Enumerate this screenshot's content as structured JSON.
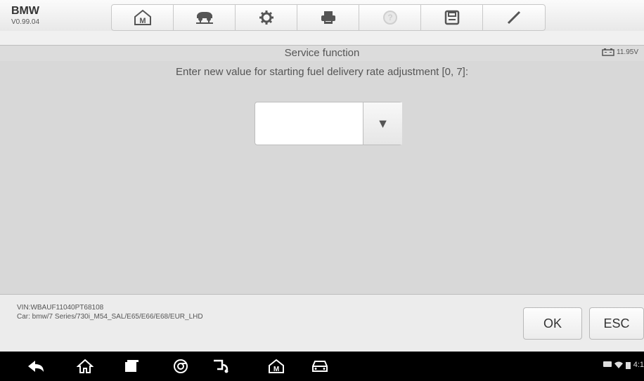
{
  "header": {
    "brand": "BMW",
    "version": "V0.99.04"
  },
  "toolbar": {
    "icons": [
      "home-m-icon",
      "car-lift-icon",
      "gear-icon",
      "print-icon",
      "help-icon",
      "save-icon",
      "pen-icon"
    ]
  },
  "titlebar": {
    "title": "Service function",
    "battery": "11.95V"
  },
  "main": {
    "prompt": "Enter new value for starting fuel delivery rate adjustment [0, 7]:",
    "dropdown_glyph": "▼"
  },
  "footer": {
    "vin": "VIN:WBAUF11040PT68108",
    "car": "Car: bmw/7 Series/730i_M54_SAL/E65/E66/E68/EUR_LHD",
    "ok": "OK",
    "esc": "ESC"
  },
  "navbar": {
    "icons": [
      "back-icon",
      "home-icon",
      "recent-apps-icon",
      "chrome-icon",
      "vci-icon",
      "maxisys-home-icon",
      "car-icon"
    ],
    "status_time": "4:1"
  },
  "colors": {
    "background": "#d8d8d8",
    "navbar": "#000000",
    "toolbar": "#f2f2f2"
  }
}
